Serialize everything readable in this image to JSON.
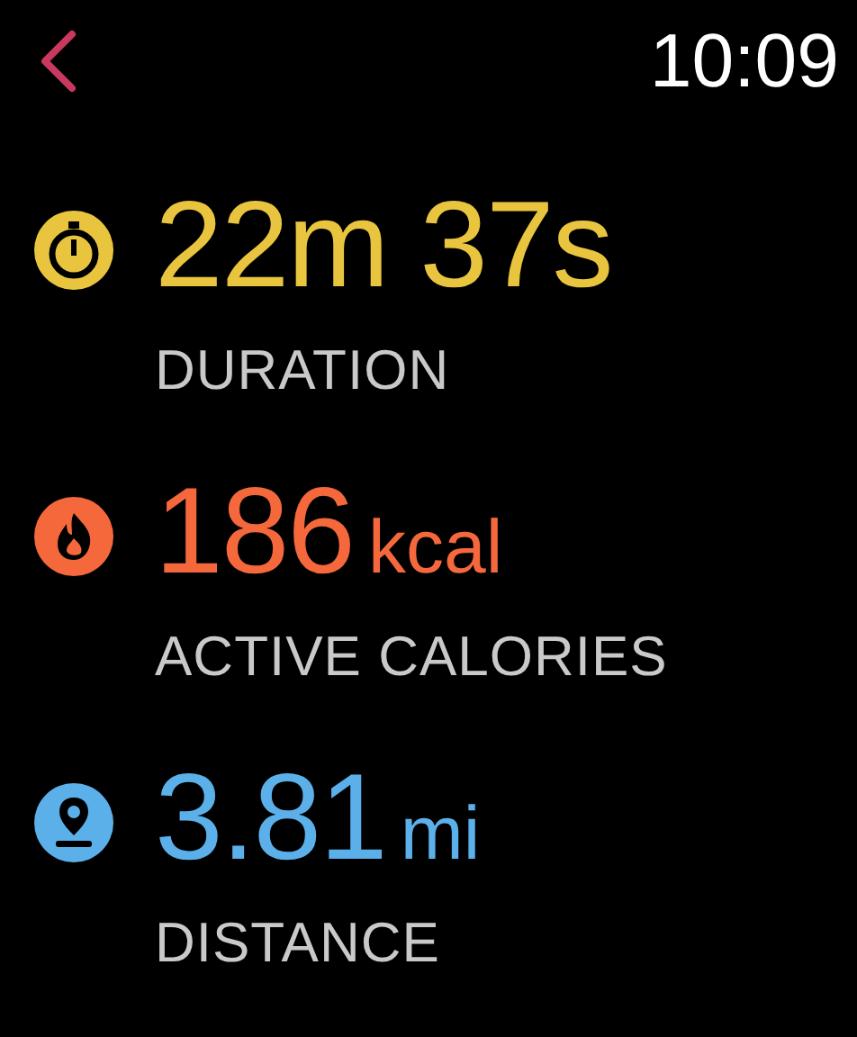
{
  "status_bar": {
    "time": "10:09"
  },
  "metrics": [
    {
      "kind": "duration",
      "value": "22m 37s",
      "label": "DURATION",
      "color": "#e9c53f"
    },
    {
      "kind": "calories",
      "value": "186",
      "unit": "kcal",
      "label": "ACTIVE CALORIES",
      "color": "#f4683c"
    },
    {
      "kind": "distance",
      "value": "3.81",
      "unit": "mi",
      "label": "DISTANCE",
      "color": "#5cb0ea"
    }
  ]
}
